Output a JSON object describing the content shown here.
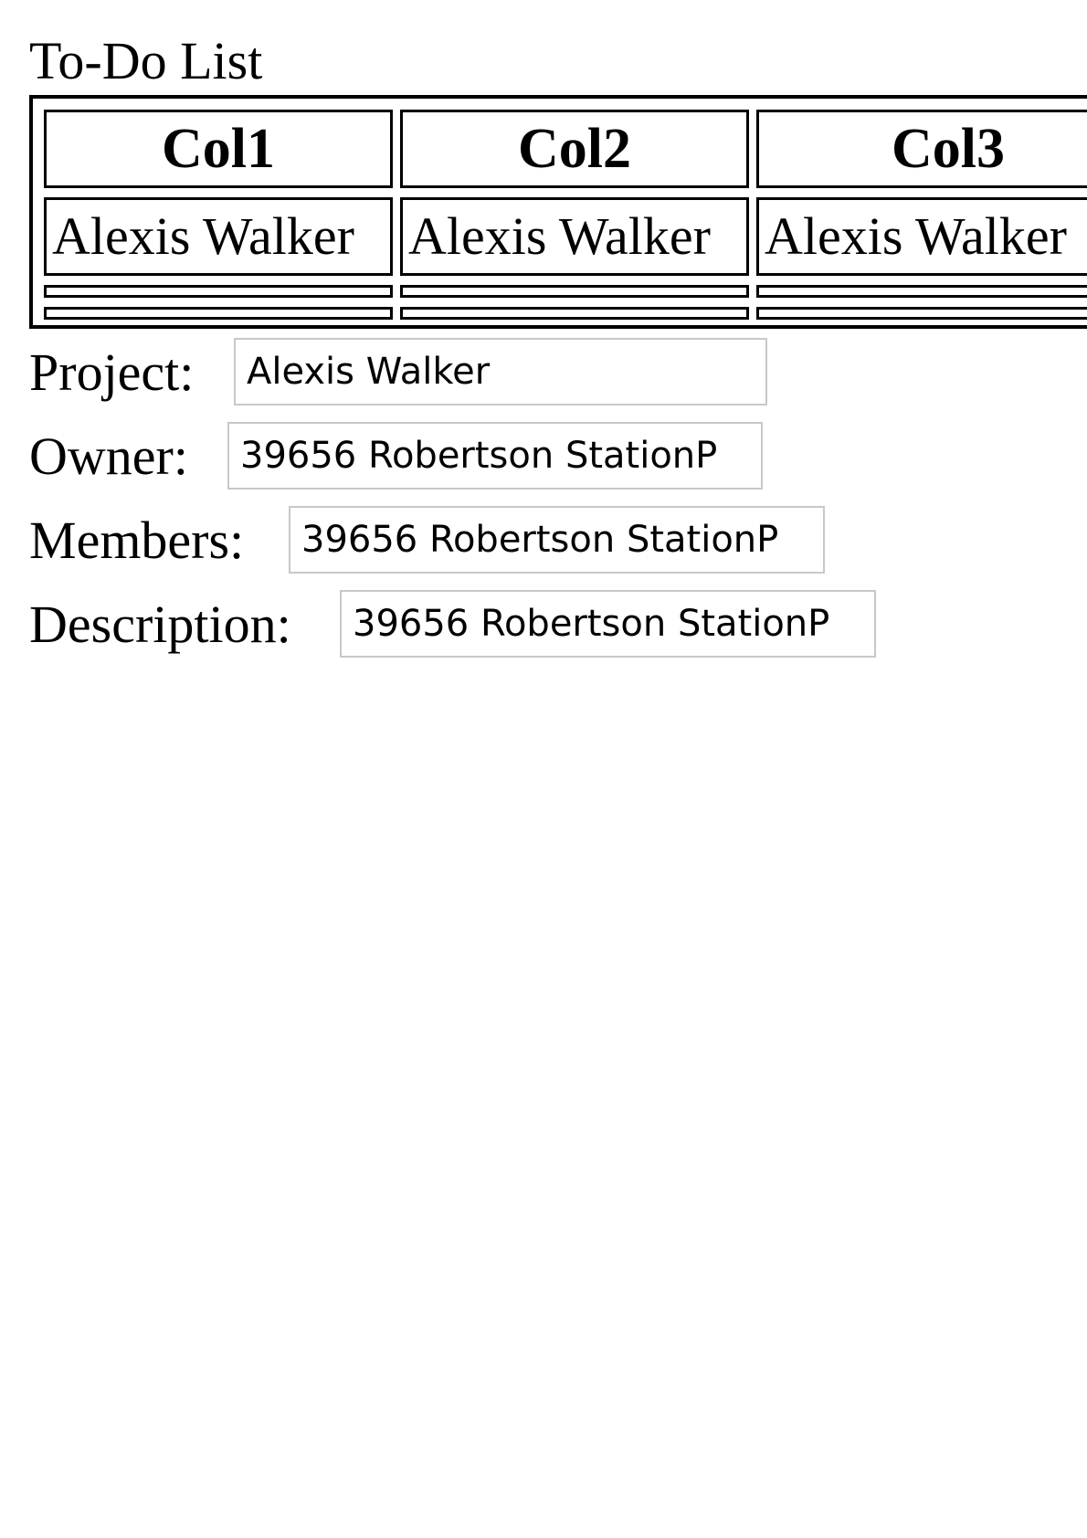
{
  "page": {
    "title": "To-Do List"
  },
  "table": {
    "headers": [
      "Col1",
      "Col2",
      "Col3"
    ],
    "rows": [
      [
        "Alexis Walker",
        "Alexis Walker",
        "Alexis Walker"
      ],
      [
        "",
        "",
        ""
      ],
      [
        "",
        "",
        ""
      ]
    ]
  },
  "form": {
    "project": {
      "label": "Project:",
      "value": "Alexis Walker"
    },
    "owner": {
      "label": "Owner:",
      "value": "39656 Robertson StationP"
    },
    "members": {
      "label": "Members:",
      "value": "39656 Robertson StationP"
    },
    "description": {
      "label": "Description:",
      "value": "39656 Robertson StationP"
    }
  }
}
